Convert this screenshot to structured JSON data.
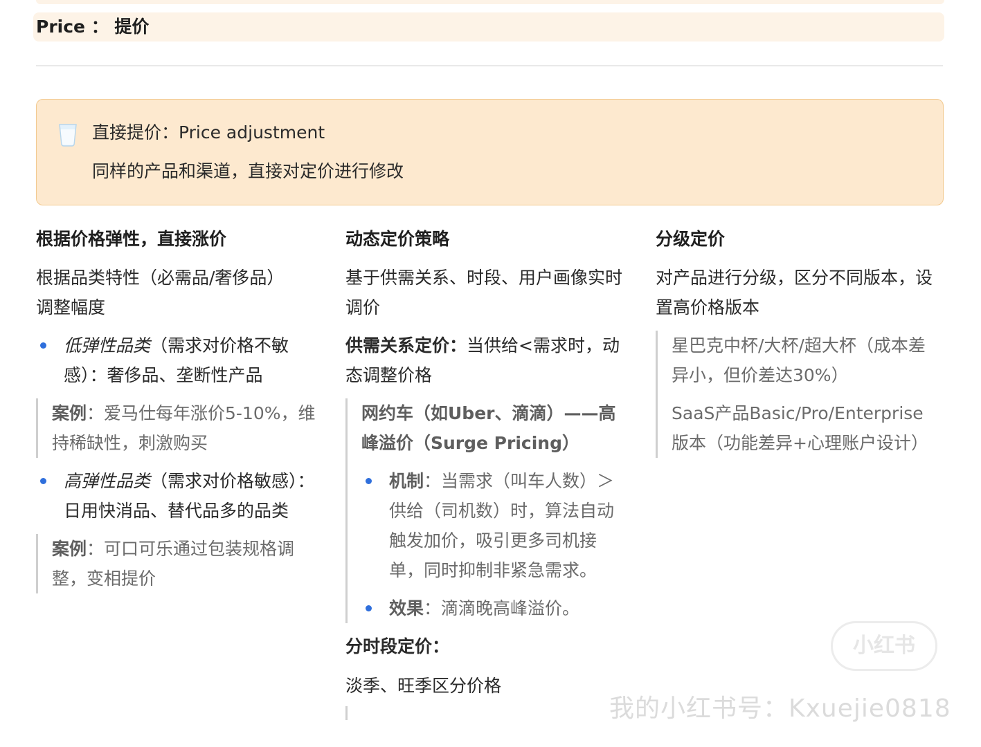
{
  "header": {
    "price_label": "Price ： 提价"
  },
  "callout": {
    "title": "直接提价：Price adjustment",
    "description": "同样的产品和渠道，直接对定价进行修改"
  },
  "col1": {
    "heading": "根据价格弹性，直接涨价",
    "intro_1": "根据品类特性（必需品/奢侈品）",
    "intro_2": "调整幅度",
    "b1_em": "低弹性品类",
    "b1_rest": "（需求对价格不敏感）：奢侈品、垄断性产品",
    "q1_label": "案例",
    "q1_text": "：爱马仕每年涨价5-10%，维持稀缺性，刺激购买",
    "b2_em": "高弹性品类",
    "b2_rest": "（需求对价格敏感）：日用快消品、替代品多的品类",
    "q2_label": "案例",
    "q2_text": "：可口可乐通过包装规格调整，变相提价"
  },
  "col2": {
    "heading": "动态定价策略",
    "intro": "基于供需关系、时段、用户画像实时调价",
    "p2_bold": "供需关系定价：",
    "p2_rest": "当供给<需求时，动态调整价格",
    "quote_title": "网约车（如Uber、滴滴）——高峰溢价（Surge Pricing）",
    "qb1_label": "机制",
    "qb1_text": "：当需求（叫车人数）＞供给（司机数）时，算法自动触发加价，吸引更多司机接单，同时抑制非紧急需求。",
    "qb2_label": "效果",
    "qb2_text": "：滴滴晚高峰溢价。",
    "p3_bold": "分时段定价：",
    "p3_text": "淡季、旺季区分价格"
  },
  "col3": {
    "heading": "分级定价",
    "intro": "对产品进行分级，区分不同版本，设置高价格版本",
    "q1": "星巴克中杯/大杯/超大杯（成本差异小，但价差达30%）",
    "q2": "SaaS产品Basic/Pro/Enterprise版本（功能差异+心理账户设计）"
  },
  "watermark": {
    "badge": "小红书",
    "text": "我的小红书号：Kxuejie0818"
  },
  "colors": {
    "accent_dot": "#2f6fdc",
    "callout_bg": "#fde9cf",
    "callout_border": "#f2c98f",
    "price_bg": "#fdf3e7"
  },
  "icons": {
    "callout_icon": "cup-icon",
    "bullet": "bullet-dot-icon"
  }
}
